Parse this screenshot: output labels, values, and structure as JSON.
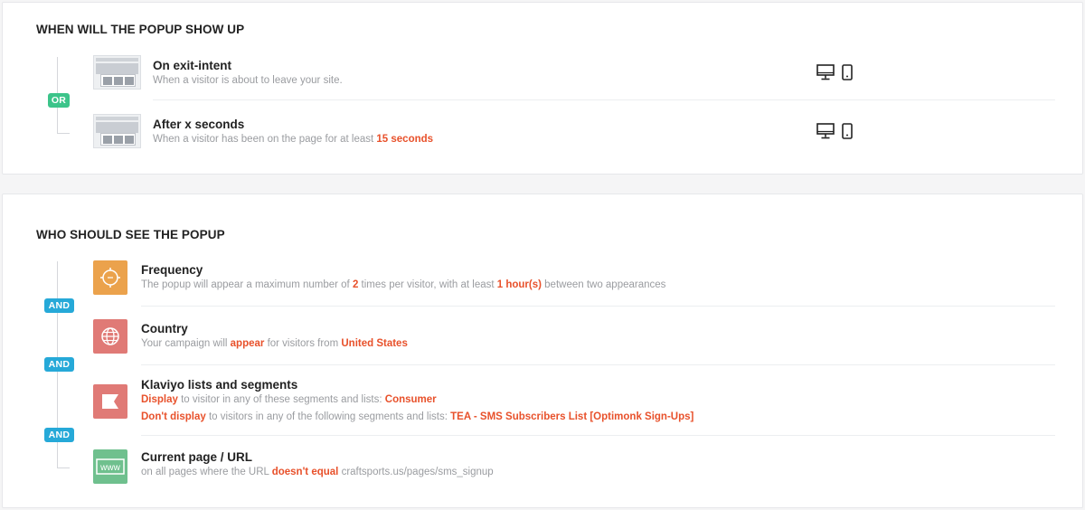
{
  "show_up": {
    "title": "WHEN WILL THE POPUP SHOW UP",
    "connector": "OR",
    "items": [
      {
        "title": "On exit-intent",
        "desc": "When a visitor is about to leave your site."
      },
      {
        "title": "After x seconds",
        "desc_prefix": "When a visitor has been on the page for at least ",
        "desc_value": "15 seconds"
      }
    ]
  },
  "audience": {
    "title": "WHO SHOULD SEE THE POPUP",
    "connector": "AND",
    "frequency": {
      "title": "Frequency",
      "d1": "The popup will appear a maximum number of ",
      "v1": "2",
      "d2": " times per visitor, with at least ",
      "v2": "1 hour(s)",
      "d3": " between two appearances",
      "icon": "clock-icon",
      "color": "#eba24c"
    },
    "country": {
      "title": "Country",
      "d1": "Your campaign will ",
      "v1": "appear",
      "d2": " for visitors from ",
      "v2": "United States",
      "icon": "globe-icon",
      "color": "#e07a76"
    },
    "klaviyo": {
      "title": "Klaviyo lists and segments",
      "l1_v1": "Display",
      "l1_d1": " to visitor in any of these segments and lists: ",
      "l1_v2": "Consumer",
      "l2_v1": "Don't display",
      "l2_d1": " to visitors in any of the following segments and lists: ",
      "l2_v2": "TEA - SMS Subscribers List [Optimonk Sign-Ups]",
      "icon": "flag-icon",
      "color": "#e07a76"
    },
    "url": {
      "title": "Current page / URL",
      "d1": "on all pages where the URL ",
      "v1": "doesn't equal",
      "d2": " craftsports.us/pages/sms_signup",
      "icon_text": "www",
      "icon": "www-icon",
      "color": "#6fc08e"
    }
  }
}
